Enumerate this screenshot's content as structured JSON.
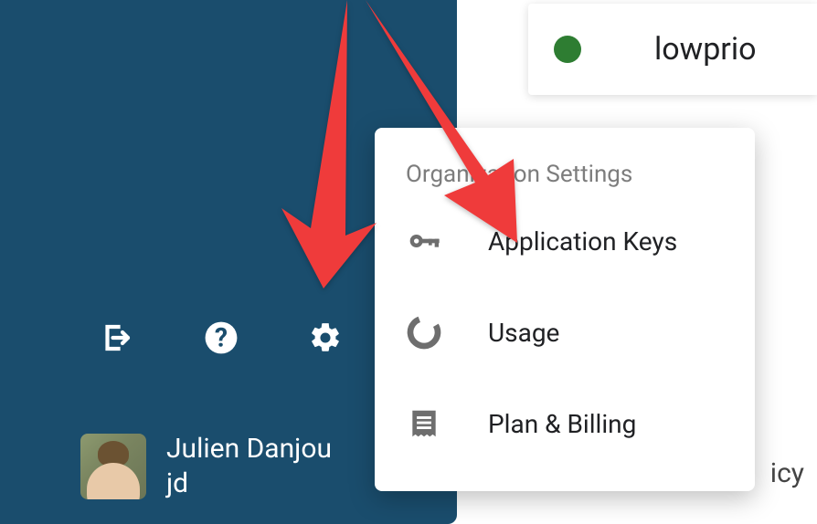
{
  "status": {
    "label": "lowprio",
    "color": "#2e7d32"
  },
  "sidebar": {
    "user": {
      "name": "Julien Danjou",
      "username": "jd"
    }
  },
  "popup": {
    "header": "Organization Settings",
    "items": [
      {
        "label": "Application Keys",
        "icon": "key-icon"
      },
      {
        "label": "Usage",
        "icon": "usage-icon"
      },
      {
        "label": "Plan & Billing",
        "icon": "billing-icon"
      }
    ]
  },
  "truncated": "icy"
}
